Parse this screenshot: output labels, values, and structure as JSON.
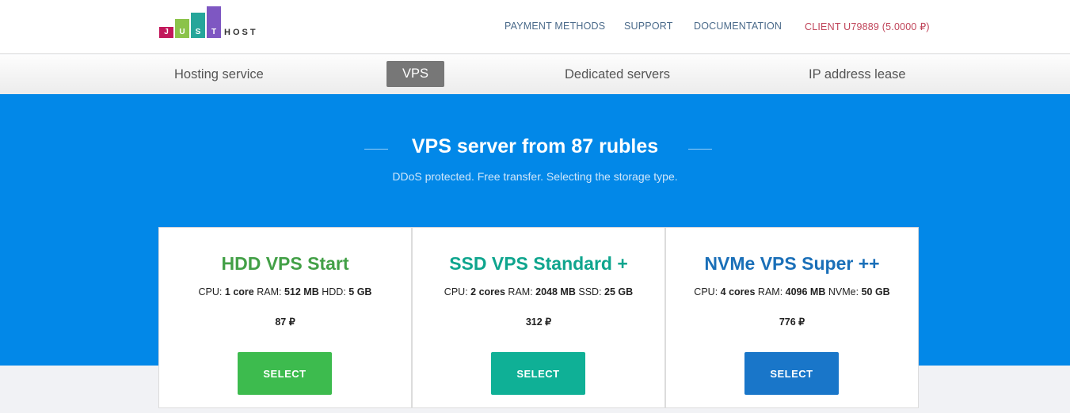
{
  "logo": {
    "letters": [
      "J",
      "U",
      "S",
      "T"
    ],
    "word": "HOST",
    "colors": [
      "#c2185b",
      "#8bc34a",
      "#26a69a",
      "#7e57c2"
    ]
  },
  "topnav": {
    "payment": "PAYMENT METHODS",
    "support": "SUPPORT",
    "documentation": "DOCUMENTATION",
    "client": "CLIENT U79889 (5.0000 ₽)"
  },
  "subnav": {
    "hosting": "Hosting service",
    "vps": "VPS",
    "dedicated": "Dedicated servers",
    "ip": "IP address lease"
  },
  "hero": {
    "title": "VPS server from 87 rubles",
    "subtitle": "DDoS protected. Free transfer. Selecting the storage type."
  },
  "plans": [
    {
      "name": "HDD VPS Start",
      "color": "#43a047",
      "button_color": "#3dbb4e",
      "cpu_label": "CPU:",
      "cpu": "1 core",
      "ram_label": "RAM:",
      "ram": "512 MB",
      "storage_label": "HDD:",
      "storage": "5 GB",
      "price": "87 ₽",
      "button": "SELECT"
    },
    {
      "name": "SSD VPS Standard +",
      "color": "#0fa58e",
      "button_color": "#0fb096",
      "cpu_label": "CPU:",
      "cpu": "2 cores",
      "ram_label": "RAM:",
      "ram": "2048 MB",
      "storage_label": "SSD:",
      "storage": "25 GB",
      "price": "312 ₽",
      "button": "SELECT"
    },
    {
      "name": "NVMe VPS Super ++",
      "color": "#1a6fb8",
      "button_color": "#1976c9",
      "cpu_label": "CPU:",
      "cpu": "4 cores",
      "ram_label": "RAM:",
      "ram": "4096 MB",
      "storage_label": "NVMe:",
      "storage": "50 GB",
      "price": "776 ₽",
      "button": "SELECT"
    }
  ]
}
